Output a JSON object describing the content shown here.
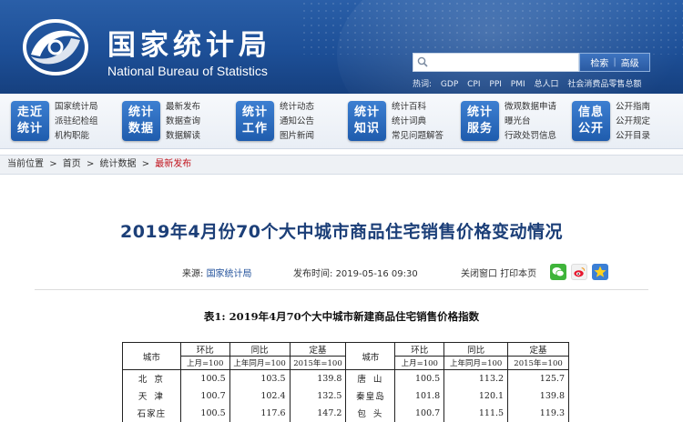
{
  "header": {
    "logo_cn": "国家统计局",
    "logo_en": "National Bureau of Statistics",
    "search": {
      "value": "",
      "placeholder": ""
    },
    "search_button": "检索",
    "advanced_button": "高级",
    "hot_label": "热词:",
    "hot_words": [
      "GDP",
      "CPI",
      "PPI",
      "PMI",
      "总人口",
      "社会消费品零售总额"
    ]
  },
  "nav": [
    {
      "badge_l1": "走近",
      "badge_l2": "统计",
      "links": [
        "国家统计局",
        "派驻纪检组",
        "机构职能"
      ]
    },
    {
      "badge_l1": "统计",
      "badge_l2": "数据",
      "links": [
        "最新发布",
        "数据查询",
        "数据解读"
      ]
    },
    {
      "badge_l1": "统计",
      "badge_l2": "工作",
      "links": [
        "统计动态",
        "通知公告",
        "图片新闻"
      ]
    },
    {
      "badge_l1": "统计",
      "badge_l2": "知识",
      "links": [
        "统计百科",
        "统计词典",
        "常见问题解答"
      ]
    },
    {
      "badge_l1": "统计",
      "badge_l2": "服务",
      "links": [
        "微观数据申请",
        "曝光台",
        "行政处罚信息"
      ]
    },
    {
      "badge_l1": "信息",
      "badge_l2": "公开",
      "links": [
        "公开指南",
        "公开规定",
        "公开目录"
      ]
    }
  ],
  "breadcrumb": {
    "label": "当前位置",
    "items": [
      "首页",
      "统计数据"
    ],
    "current": "最新发布"
  },
  "article": {
    "title": "2019年4月份70个大中城市商品住宅销售价格变动情况",
    "source_label": "来源:",
    "source_value": "国家统计局",
    "published_label": "发布时间:",
    "published_value": "2019-05-16 09:30",
    "close_window": "关闭窗口",
    "print": "打印本页",
    "share_icons": [
      "wechat-icon",
      "weibo-icon",
      "favorite-icon"
    ]
  },
  "table": {
    "caption": "表1: 2019年4月70个大中城市新建商品住宅销售价格指数",
    "col_city": "城市",
    "col_mom": "环比",
    "col_yoy": "同比",
    "col_base": "定基",
    "sub_mom": "上月=100",
    "sub_yoy": "上年同月=100",
    "sub_base": "2015年=100",
    "rows": [
      {
        "c1": "北京",
        "m1": "100.5",
        "y1": "103.5",
        "b1": "139.8",
        "c2": "唐山",
        "m2": "100.5",
        "y2": "113.2",
        "b2": "125.7"
      },
      {
        "c1": "天津",
        "m1": "100.7",
        "y1": "102.4",
        "b1": "132.5",
        "c2": "秦皇岛",
        "m2": "101.8",
        "y2": "120.1",
        "b2": "139.8"
      },
      {
        "c1": "石家庄",
        "m1": "100.5",
        "y1": "117.6",
        "b1": "147.2",
        "c2": "包头",
        "m2": "100.7",
        "y2": "111.5",
        "b2": "119.3"
      }
    ]
  },
  "colors": {
    "header_blue": "#1d4f97",
    "title_blue": "#1c3f78",
    "breadcrumb_current": "#c1121c"
  }
}
